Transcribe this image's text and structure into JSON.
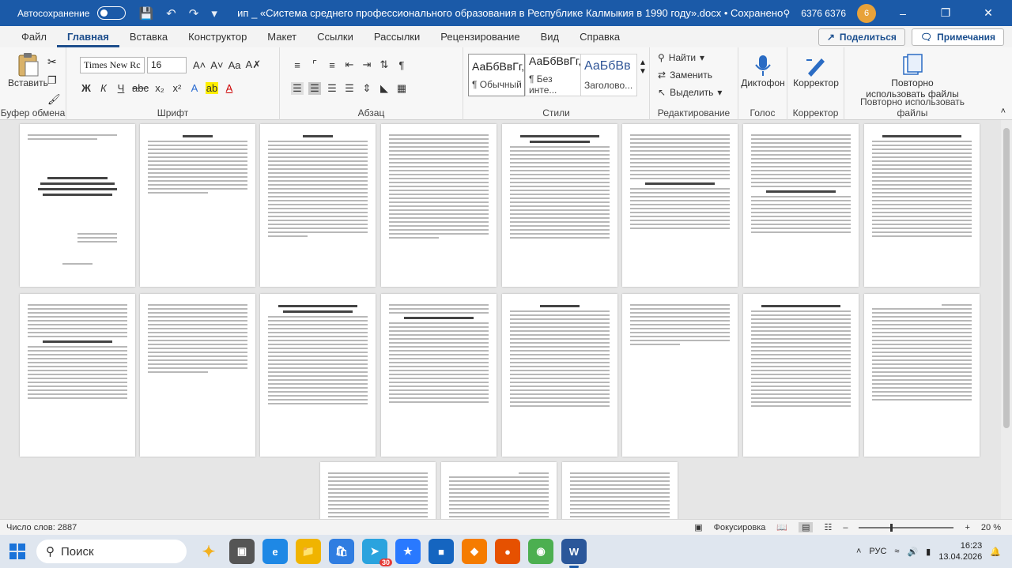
{
  "titlebar": {
    "autosave_label": "Автосохранение",
    "doc_title": "ип _ «Система среднего профессионального образования в Республике Калмыкия в 1990 году».docx  •  Сохранено",
    "search_placeholder": "",
    "user_name": "6376 6376",
    "avatar_initials": "6"
  },
  "menu": {
    "items": [
      "Файл",
      "Главная",
      "Вставка",
      "Конструктор",
      "Макет",
      "Ссылки",
      "Рассылки",
      "Рецензирование",
      "Вид",
      "Справка"
    ],
    "share": "Поделиться",
    "comments": "Примечания"
  },
  "ribbon": {
    "paste": "Вставить",
    "clipboard": "Буфер обмена",
    "font_name": "Times New Rc",
    "font_size": "16",
    "font_group": "Шрифт",
    "paragraph_group": "Абзац",
    "styles": [
      {
        "sample": "АаБбВвГг,",
        "name": "¶ Обычный"
      },
      {
        "sample": "АаБбВвГг,",
        "name": "¶ Без инте..."
      },
      {
        "sample": "АаБбВв",
        "name": "Заголово..."
      }
    ],
    "styles_group": "Стили",
    "find": "Найти",
    "replace": "Заменить",
    "select": "Выделить",
    "editing_group": "Редактирование",
    "dictation": "Диктофон",
    "voice_group": "Голос",
    "editor": "Корректор",
    "editor_group": "Корректор",
    "reuse": "Повторно использовать файлы",
    "reuse_group": "Повторно использовать файлы"
  },
  "status": {
    "words": "Число слов: 2887",
    "focus": "Фокусировка",
    "zoom": "20 %"
  },
  "taskbar": {
    "search": "Поиск",
    "lang": "РУС",
    "time": "16:23",
    "date": "13.04.2026",
    "badge": "30"
  }
}
